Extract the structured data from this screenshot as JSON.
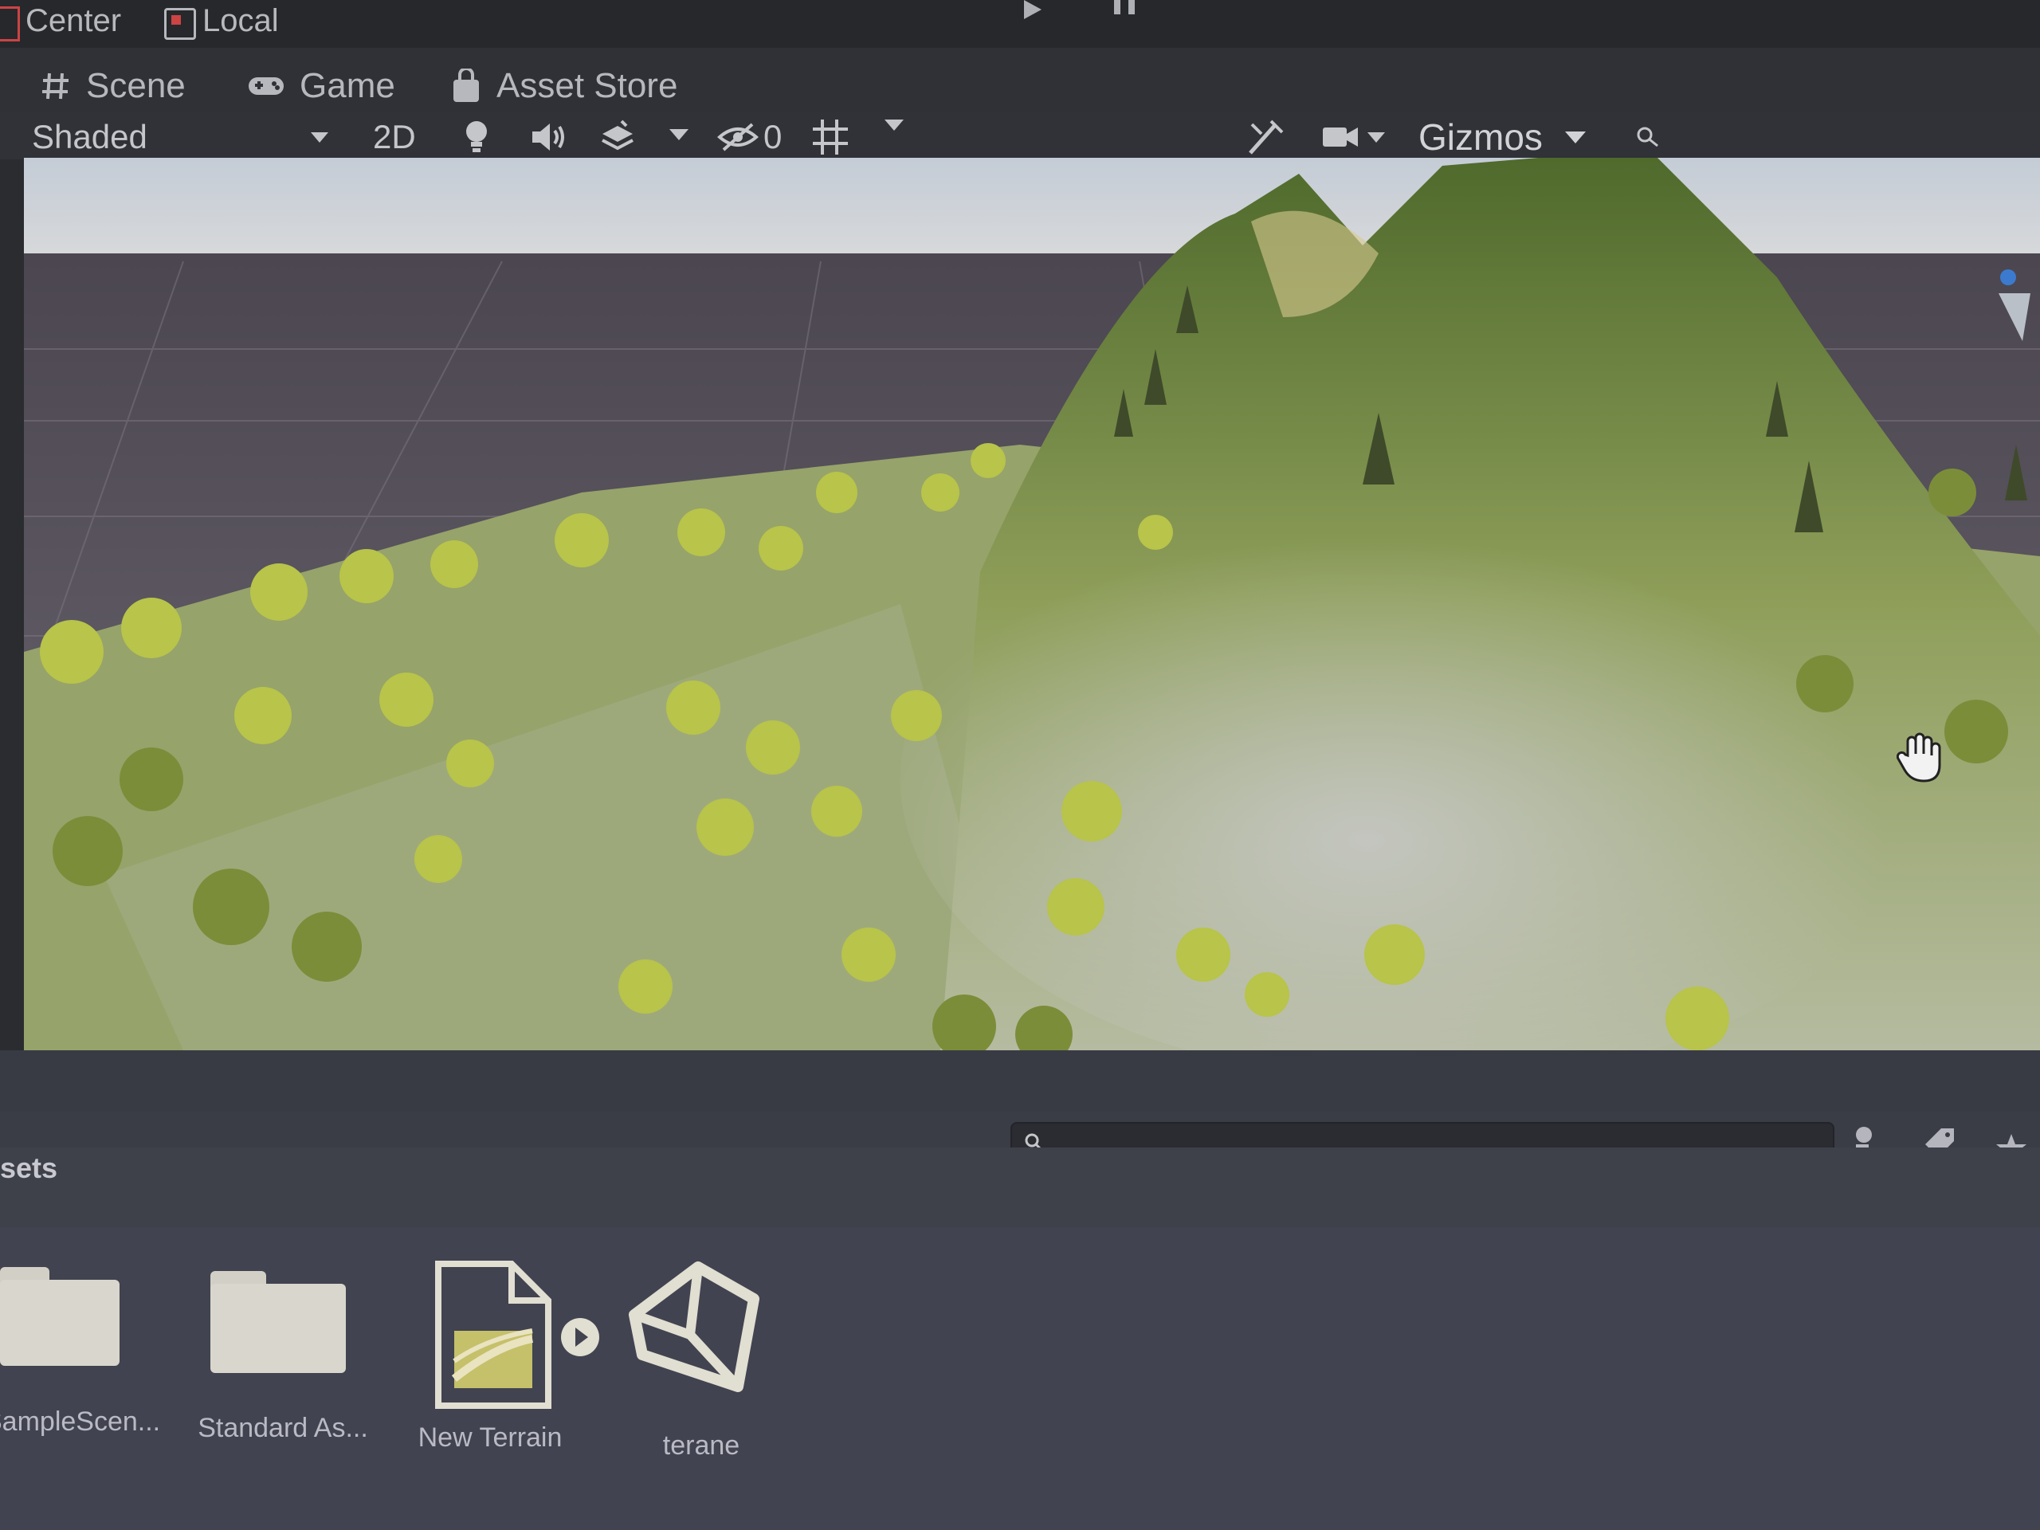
{
  "toolbar_top": {
    "pivot_center": "Center",
    "pivot_local": "Local"
  },
  "tabs": [
    {
      "label": "Scene",
      "icon": "hash-icon"
    },
    {
      "label": "Game",
      "icon": "gamepad-icon"
    },
    {
      "label": "Asset Store",
      "icon": "shopping-bag-icon"
    }
  ],
  "scene_toolbar": {
    "draw_mode": "Shaded",
    "mode_2d": "2D",
    "hidden_count": "0",
    "gizmos": "Gizmos"
  },
  "project": {
    "breadcrumb": "sets",
    "search_placeholder": ""
  },
  "assets": [
    {
      "label": "SampleScen...",
      "icon": "folder-icon"
    },
    {
      "label": "Standard As...",
      "icon": "folder-icon"
    },
    {
      "label": "New Terrain",
      "icon": "terrain-file-icon"
    },
    {
      "label": "terane",
      "icon": "unity-prefab-icon"
    }
  ],
  "colors": {
    "editor_bg": "#2f3136",
    "panel_bg": "#393b44",
    "grass": "#9aa86a",
    "sky": "#c9d3de"
  }
}
